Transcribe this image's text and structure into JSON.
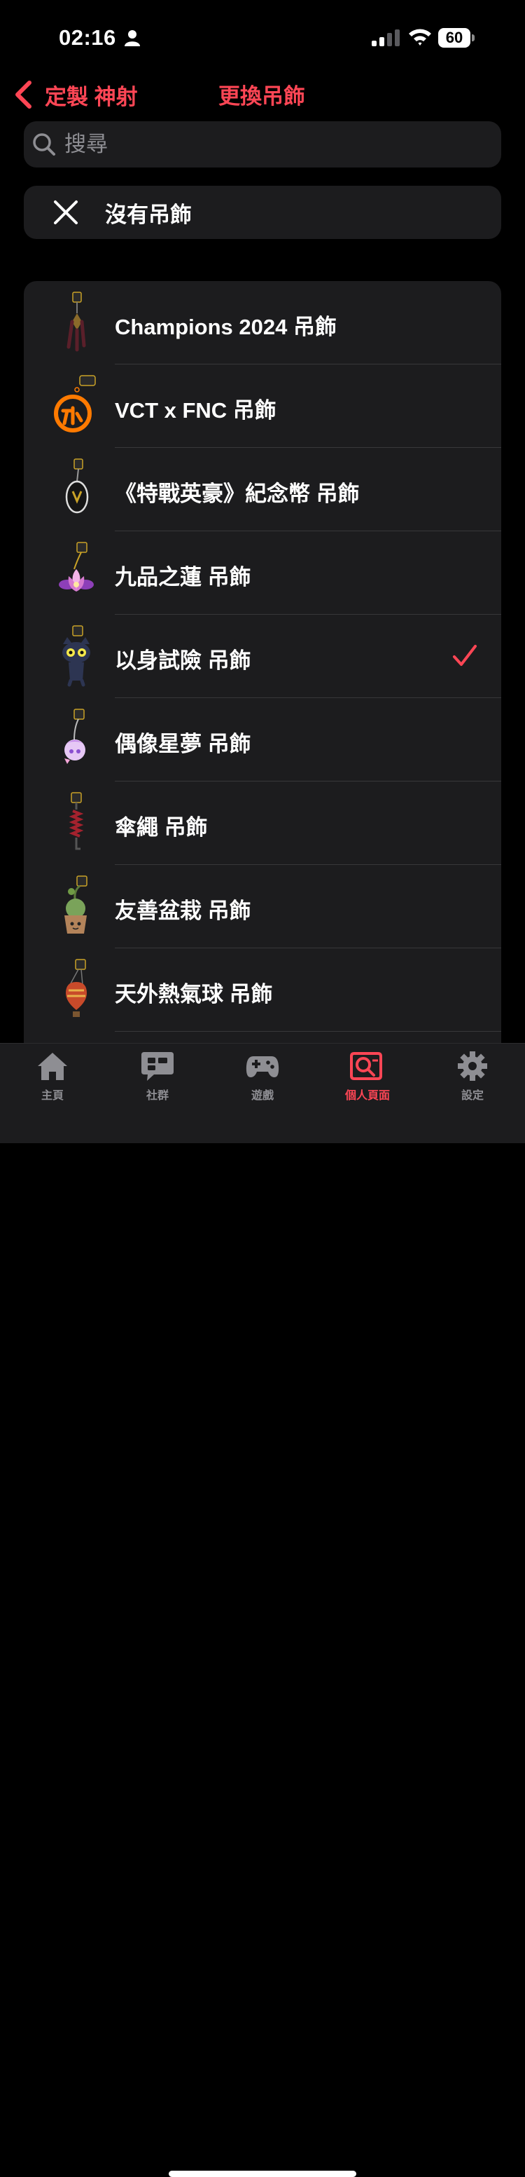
{
  "status_bar": {
    "time": "02:16",
    "battery": "60"
  },
  "nav": {
    "back_label": "定製 神射",
    "title": "更換吊飾"
  },
  "search": {
    "placeholder": "搜尋",
    "value": ""
  },
  "none_option": {
    "label": "沒有吊飾",
    "icon": "close-icon"
  },
  "items": [
    {
      "label": "Champions 2024 吊飾",
      "selected": false
    },
    {
      "label": "VCT x FNC 吊飾",
      "selected": false
    },
    {
      "label": "《特戰英豪》紀念幣 吊飾",
      "selected": false
    },
    {
      "label": "九品之蓮 吊飾",
      "selected": false
    },
    {
      "label": "以身試險 吊飾",
      "selected": true
    },
    {
      "label": "偶像星夢 吊飾",
      "selected": false
    },
    {
      "label": "傘繩 吊飾",
      "selected": false
    },
    {
      "label": "友善盆栽 吊飾",
      "selected": false
    },
    {
      "label": "天外熱氣球 吊飾",
      "selected": false
    }
  ],
  "tabs": [
    {
      "label": "主頁",
      "icon": "home-icon",
      "active": false
    },
    {
      "label": "社群",
      "icon": "chat-icon",
      "active": false
    },
    {
      "label": "遊戲",
      "icon": "gamepad-icon",
      "active": false
    },
    {
      "label": "個人頁面",
      "icon": "profile-search-icon",
      "active": true
    },
    {
      "label": "設定",
      "icon": "gear-icon",
      "active": false
    }
  ],
  "colors": {
    "accent": "#ff4655",
    "background": "#000000",
    "surface": "#1c1c1e",
    "muted": "#8e8e93"
  }
}
